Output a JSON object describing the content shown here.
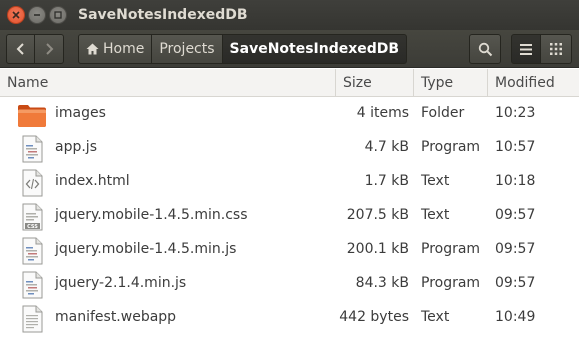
{
  "window": {
    "title": "SaveNotesIndexedDB"
  },
  "breadcrumbs": [
    {
      "label": "Home",
      "icon": "home-icon"
    },
    {
      "label": "Projects"
    },
    {
      "label": "SaveNotesIndexedDB",
      "active": true
    }
  ],
  "columns": {
    "name": "Name",
    "size": "Size",
    "type": "Type",
    "modified": "Modified"
  },
  "files": [
    {
      "name": "images",
      "size": "4 items",
      "type": "Folder",
      "modified": "10:23",
      "icon": "folder-icon"
    },
    {
      "name": "app.js",
      "size": "4.7 kB",
      "type": "Program",
      "modified": "10:57",
      "icon": "script-file-icon"
    },
    {
      "name": "index.html",
      "size": "1.7 kB",
      "type": "Text",
      "modified": "10:18",
      "icon": "html-file-icon"
    },
    {
      "name": "jquery.mobile-1.4.5.min.css",
      "size": "207.5 kB",
      "type": "Text",
      "modified": "09:57",
      "icon": "css-file-icon"
    },
    {
      "name": "jquery.mobile-1.4.5.min.js",
      "size": "200.1 kB",
      "type": "Program",
      "modified": "09:57",
      "icon": "script-file-icon"
    },
    {
      "name": "jquery-2.1.4.min.js",
      "size": "84.3 kB",
      "type": "Program",
      "modified": "09:57",
      "icon": "script-file-icon"
    },
    {
      "name": "manifest.webapp",
      "size": "442 bytes",
      "type": "Text",
      "modified": "10:49",
      "icon": "text-file-icon"
    }
  ],
  "colors": {
    "titlebar": "#3c3b37",
    "close_button": "#e95420",
    "folder": "#e95c20"
  }
}
